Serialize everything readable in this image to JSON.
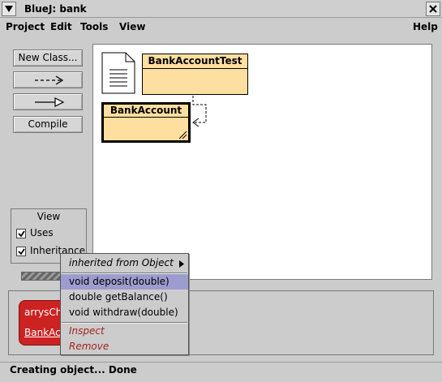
{
  "window": {
    "title": "BlueJ:  bank"
  },
  "menubar": {
    "items": [
      "Project",
      "Edit",
      "Tools",
      "View"
    ],
    "help": "Help"
  },
  "tools": {
    "new_class": "New Class...",
    "compile": "Compile"
  },
  "view_panel": {
    "title": "View",
    "uses": "Uses",
    "inheritance": "Inheritance",
    "uses_checked": true,
    "inheritance_checked": true
  },
  "classes": [
    {
      "name": "BankAccountTest"
    },
    {
      "name": "BankAccount"
    }
  ],
  "object_bench": {
    "object_name": "arrysChe",
    "object_type": "BankAcc"
  },
  "context_menu": {
    "inherited": "inherited from Object",
    "methods": [
      "void deposit(double)",
      "double getBalance()",
      "void withdraw(double)"
    ],
    "inspect": "Inspect",
    "remove": "Remove"
  },
  "status": {
    "text": "Creating object... Done"
  },
  "colors": {
    "class_fill": "#ffdf9f",
    "object_fill": "#cc2222",
    "menu_highlight": "#9c9ccf"
  }
}
